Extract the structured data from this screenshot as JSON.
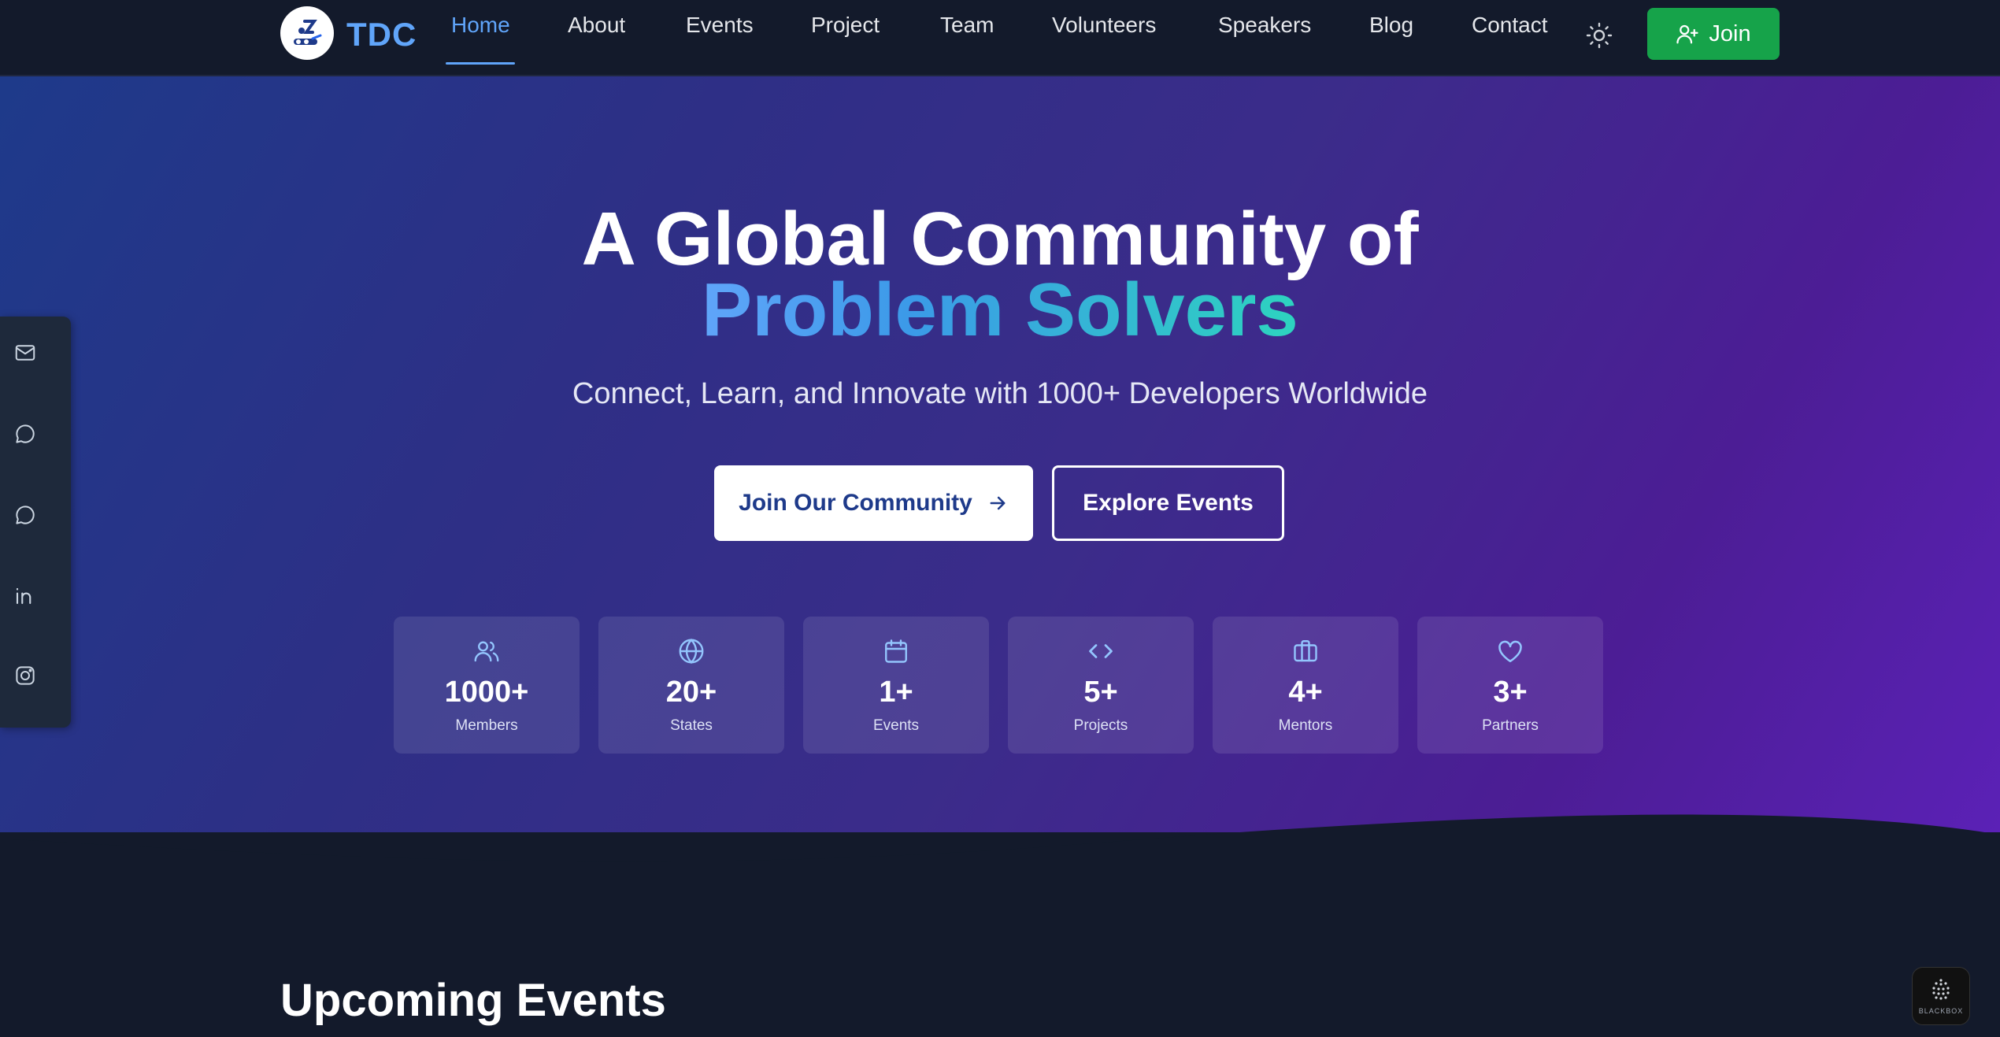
{
  "brand": {
    "name": "TDC",
    "accent": "#60a5fa"
  },
  "nav": {
    "items": [
      {
        "label": "Home",
        "active": true
      },
      {
        "label": "About"
      },
      {
        "label": "Events"
      },
      {
        "label": "Project"
      },
      {
        "label": "Team"
      },
      {
        "label": "Volunteers"
      },
      {
        "label": "Speakers"
      },
      {
        "label": "Blog"
      },
      {
        "label": "Contact"
      }
    ],
    "join_label": "Join",
    "theme_icon": "sun-icon"
  },
  "hero": {
    "title_line1": "A Global Community of",
    "title_line2": "Problem Solvers",
    "subtitle": "Connect, Learn, and Innovate with 1000+ Developers Worldwide",
    "primary_cta": "Join Our Community",
    "secondary_cta": "Explore Events"
  },
  "stats": [
    {
      "icon": "users-icon",
      "value": "1000+",
      "label": "Members"
    },
    {
      "icon": "globe-icon",
      "value": "20+",
      "label": "States"
    },
    {
      "icon": "calendar-icon",
      "value": "1+",
      "label": "Events"
    },
    {
      "icon": "code-icon",
      "value": "5+",
      "label": "Projects"
    },
    {
      "icon": "briefcase-icon",
      "value": "4+",
      "label": "Mentors"
    },
    {
      "icon": "heart-icon",
      "value": "3+",
      "label": "Partners"
    }
  ],
  "social": [
    "mail-icon",
    "chat-icon",
    "whatsapp-icon",
    "linkedin-icon",
    "instagram-icon"
  ],
  "upcoming": {
    "title": "Upcoming Events"
  },
  "badge": {
    "label": "BLACKBOX"
  },
  "colors": {
    "join": "#16a34a",
    "page_bg": "#131a2b"
  }
}
